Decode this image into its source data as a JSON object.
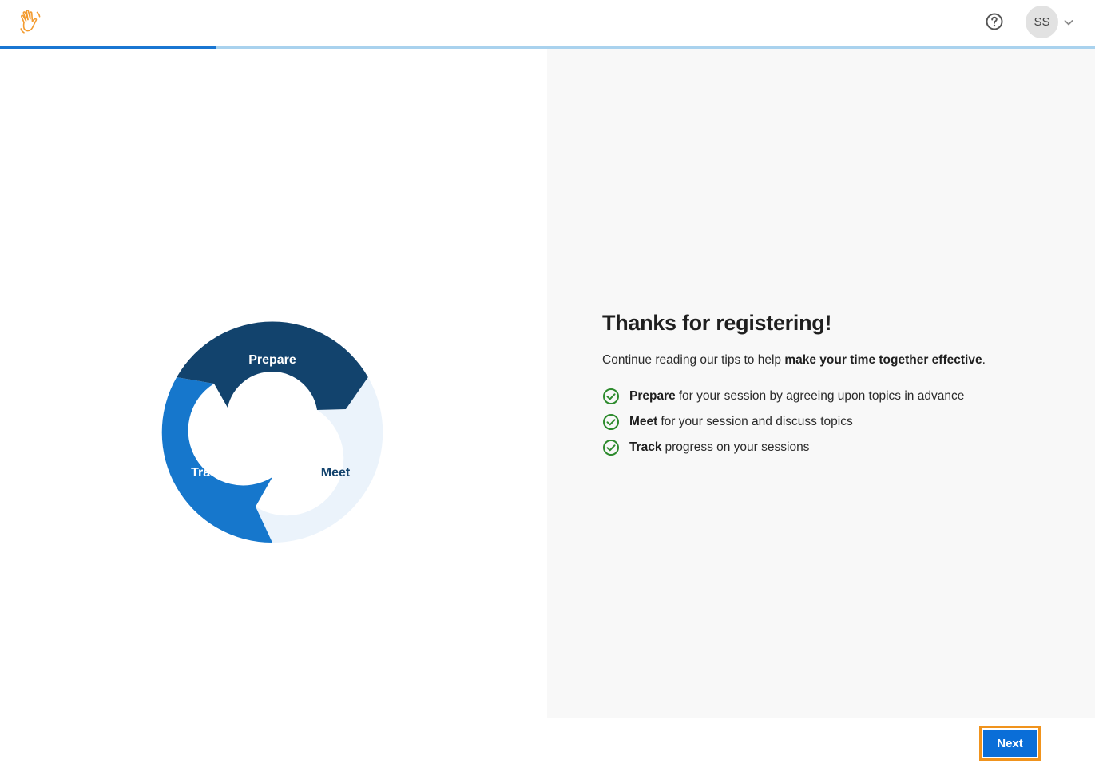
{
  "header": {
    "logo_icon": "waving-hand-icon",
    "help_icon": "question-circle-icon",
    "avatar_initials": "SS",
    "avatar_menu_icon": "chevron-down-icon"
  },
  "progress": {
    "fraction": 0.198
  },
  "cycle": {
    "segments": [
      {
        "label": "Prepare",
        "color": "#12436d",
        "text_color": "#ffffff"
      },
      {
        "label": "Meet",
        "color": "#ebf3fb",
        "text_color": "#12436d"
      },
      {
        "label": "Track",
        "color": "#1677cc",
        "text_color": "#ffffff"
      }
    ]
  },
  "content": {
    "title": "Thanks for registering!",
    "intro_prefix": "Continue reading our tips to help ",
    "intro_bold": "make your time together effective",
    "intro_suffix": ".",
    "tips": [
      {
        "bold": "Prepare",
        "text": "for your session by agreeing upon topics in advance"
      },
      {
        "bold": "Meet",
        "text": "for your session and discuss topics"
      },
      {
        "bold": "Track",
        "text": "progress on your sessions"
      }
    ],
    "check_icon": "check-circle-icon"
  },
  "footer": {
    "next_label": "Next"
  },
  "colors": {
    "accent": "#1976d2",
    "progress_track": "#a9d2ee",
    "check_green": "#2e8b2e",
    "logo_orange": "#f39b2f",
    "focus_outline": "#f0931d"
  }
}
